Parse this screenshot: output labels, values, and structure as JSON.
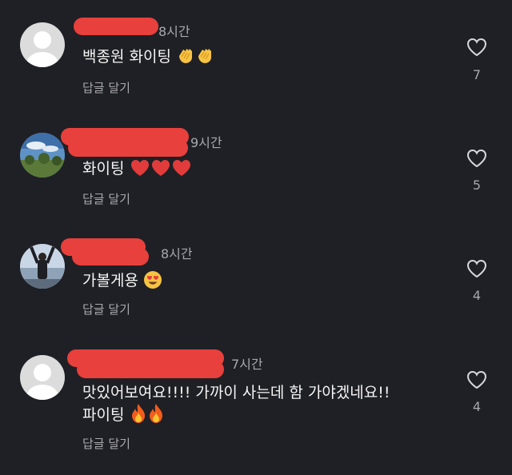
{
  "comments": [
    {
      "time": "8시간",
      "text": "백종원 화이팅",
      "emoji": "clap-icon",
      "reply": "답글 달기",
      "likes": "7"
    },
    {
      "time": "9시간",
      "text": "화이팅",
      "emoji": "heart-icon",
      "reply": "답글 달기",
      "likes": "5"
    },
    {
      "time": "8시간",
      "text": "가볼게용",
      "emoji": "heart-eyes-face-icon",
      "reply": "답글 달기",
      "likes": "4"
    },
    {
      "time": "7시간",
      "text": "맛있어보여요!!!! 가까이 사는데 함 가야겠네요!!",
      "text2": "파이팅",
      "emoji": "fire-icon",
      "reply": "답글 달기",
      "likes": "4"
    }
  ],
  "colors": {
    "background": "#1f2025",
    "redaction": "#e8403c",
    "secondary_text": "#a8a8ad"
  }
}
